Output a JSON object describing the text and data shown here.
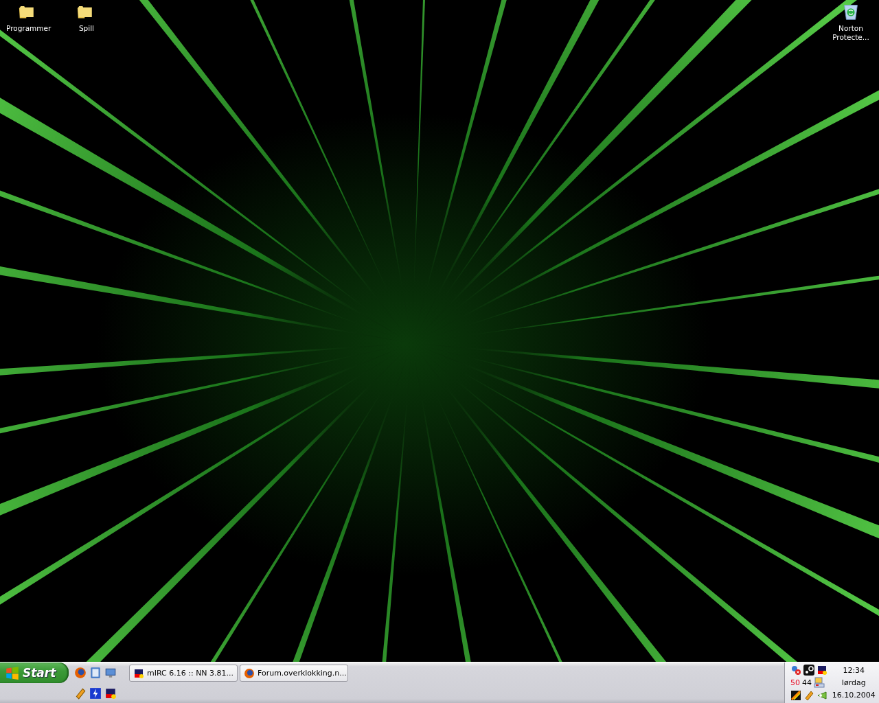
{
  "desktop_icons": [
    {
      "label": "Programmer",
      "kind": "folder"
    },
    {
      "label": "Spill",
      "kind": "folder"
    },
    {
      "label": "Norton Protecte...",
      "kind": "recycle"
    }
  ],
  "taskbar": {
    "start_button": "Start",
    "task_buttons": [
      {
        "label": "mIRC 6.16 :: NN 3.81...",
        "kind": "chat",
        "selected": false
      },
      {
        "label": "Forum.overklokking.n...",
        "kind": "browser",
        "selected": false
      }
    ],
    "tray": {
      "readings": [
        {
          "text": "50",
          "color": "#e8001c"
        },
        {
          "text": "44",
          "color": "#000000"
        }
      ],
      "time": "12:34",
      "day": "lørdag",
      "date": "16.10.2004"
    }
  }
}
